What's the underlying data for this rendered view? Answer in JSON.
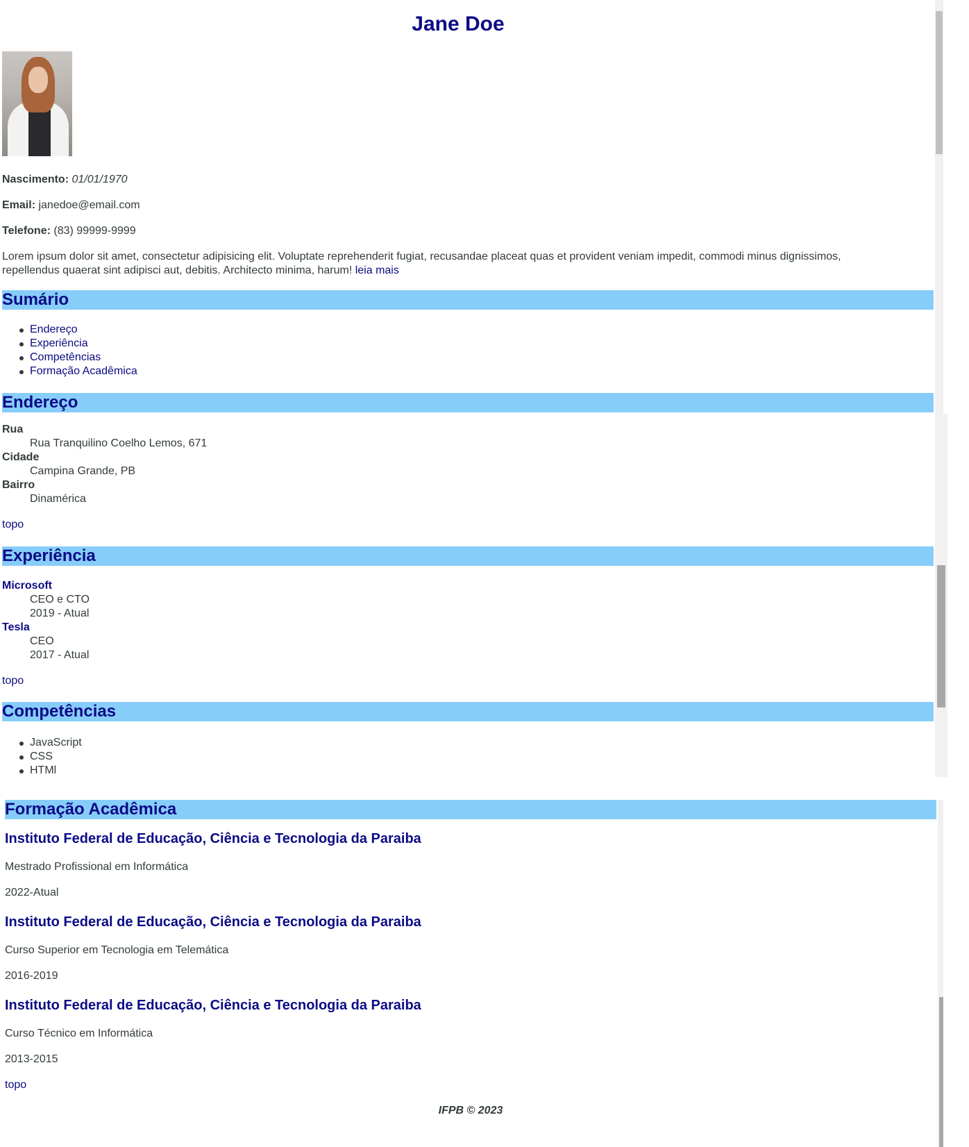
{
  "name": "Jane Doe",
  "personal": {
    "birth_label": "Nascimento:",
    "birth_value": "01/01/1970",
    "email_label": "Email:",
    "email_value": "janedoe@email.com",
    "phone_label": "Telefone:",
    "phone_value": "(83) 99999-9999"
  },
  "bio": {
    "line1": "Lorem ipsum dolor sit amet, consectetur adipisicing elit. Voluptate reprehenderit fugiat, recusandae placeat quas et provident veniam impedit, commodi minus dignissimos,",
    "line2": "repellendus quaerat sint adipisci aut, debitis. Architecto minima, harum!",
    "more_link": "leia mais"
  },
  "summary": {
    "title": "Sumário",
    "items": [
      "Endereço",
      "Experiência",
      "Competências",
      "Formação Acadêmica"
    ]
  },
  "address": {
    "title": "Endereço",
    "street_label": "Rua",
    "street_value": "Rua Tranquilino Coelho Lemos, 671",
    "city_label": "Cidade",
    "city_value": "Campina Grande, PB",
    "district_label": "Bairro",
    "district_value": "Dinamérica"
  },
  "top_link": "topo",
  "experience": {
    "title": "Experiência",
    "jobs": [
      {
        "company": "Microsoft",
        "role": "CEO e CTO",
        "period": "2019 - Atual"
      },
      {
        "company": "Tesla",
        "role": "CEO",
        "period": "2017 - Atual"
      }
    ]
  },
  "skills": {
    "title": "Competências",
    "items": [
      "JavaScript",
      "CSS",
      "HTMl"
    ]
  },
  "education": {
    "title": "Formação Acadêmica",
    "entries": [
      {
        "institution": "Instituto Federal de Educação, Ciência e Tecnologia da Paraiba",
        "course": "Mestrado Profissional em Informática",
        "period": "2022-Atual"
      },
      {
        "institution": "Instituto Federal de Educação, Ciência e Tecnologia da Paraiba",
        "course": "Curso Superior em Tecnologia em Telemática",
        "period": "2016-2019"
      },
      {
        "institution": "Instituto Federal de Educação, Ciência e Tecnologia da Paraiba",
        "course": "Curso Técnico em Informática",
        "period": "2013-2015"
      }
    ]
  },
  "footer": "IFPB © 2023",
  "colors": {
    "accent": "#87cdf9",
    "heading": "#0b0b86",
    "text": "#333b3b"
  }
}
